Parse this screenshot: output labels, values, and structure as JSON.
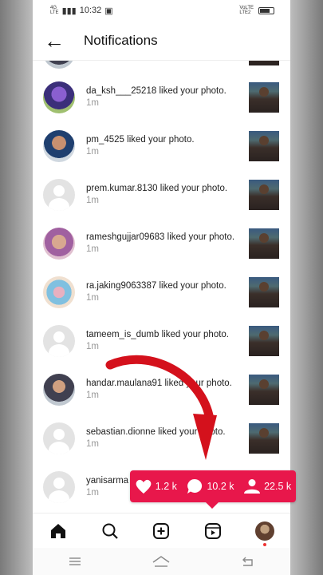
{
  "status": {
    "network_top": "4G",
    "network_bottom": "LTE",
    "time": "10:32",
    "right_top": "VoLTE",
    "right_bottom": "LTE2"
  },
  "header": {
    "back_icon": "arrow-left-icon",
    "title": "Notifications"
  },
  "notifications": [
    {
      "user": "da_ksh___25218",
      "action": "liked your photo.",
      "time": "1m",
      "avatar": "photo1"
    },
    {
      "user": "pm_4525",
      "action": "liked your photo.",
      "time": "1m",
      "avatar": "photo2"
    },
    {
      "user": "prem.kumar.8130",
      "action": "liked your photo.",
      "time": "1m",
      "avatar": "default"
    },
    {
      "user": "rameshgujjar09683",
      "action": "liked your photo.",
      "time": "1m",
      "avatar": "photo3"
    },
    {
      "user": "ra.jaking9063387",
      "action": "liked your photo.",
      "time": "1m",
      "avatar": "photo4"
    },
    {
      "user": "tameem_is_dumb",
      "action": "liked your photo.",
      "time": "1m",
      "avatar": "default"
    },
    {
      "user": "handar.maulana91",
      "action": "liked your photo.",
      "time": "1m",
      "avatar": "photo5"
    },
    {
      "user": "sebastian.dionne",
      "action": "liked your photo.",
      "time": "1m",
      "avatar": "default"
    },
    {
      "user": "yanisarma",
      "action": "",
      "time": "1m",
      "avatar": "default"
    }
  ],
  "stats": {
    "likes": "1.2 k",
    "comments": "10.2 k",
    "followers": "22.5 k"
  },
  "colors": {
    "stats_bg": "#e8174b",
    "arrow": "#d4111c"
  },
  "nav": [
    "home-icon",
    "search-icon",
    "add-post-icon",
    "reels-icon",
    "profile-avatar"
  ]
}
